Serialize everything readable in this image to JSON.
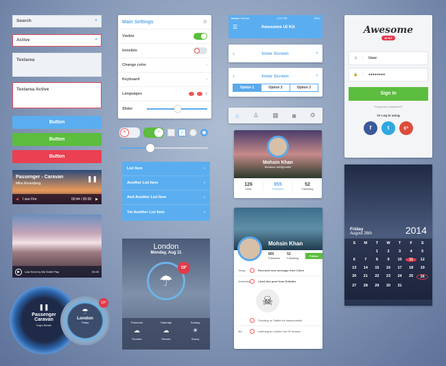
{
  "fields": {
    "search": "Search",
    "active": "Active",
    "textarea": "Textarea",
    "textarea_active": "Textarea Active"
  },
  "buttons": {
    "blue": "Button",
    "green": "Button",
    "red": "Button"
  },
  "music": {
    "title": "Passenger - Caravan",
    "artist": "Mike Rosenberg",
    "track": "I see Fire",
    "time": "00:44 / 05:00"
  },
  "video": {
    "caption": "Last Seen by Ms Smith Play",
    "time": "00:45"
  },
  "settings": {
    "title": "Main Settings",
    "rows": [
      "Visible",
      "Invisible",
      "Change color",
      "Keyboard",
      "Languages",
      "Slider"
    ]
  },
  "list": {
    "items": [
      "List Item",
      "Another List Item",
      "And Another List Item",
      "Yet Another List Item"
    ]
  },
  "weather": {
    "city": "London",
    "date": "Monday, Aug 11",
    "temp": "19°",
    "days": [
      "Tomorrow",
      "Saturday",
      "Sunday"
    ],
    "conds": [
      "Thunder",
      "Shower",
      "Sunny"
    ]
  },
  "phone": {
    "carrier": "●●●●● Verizon",
    "clock": "4:21 PM",
    "battery": "51%",
    "title": "Awesome UI Kit",
    "inner": "Inner Screen",
    "options": [
      "Option 1",
      "Option 2",
      "Option 3"
    ]
  },
  "profile": {
    "name": "Mohsin Khan",
    "sub": "Behance.net/@profile",
    "stats": [
      {
        "n": "126",
        "l": "Likes"
      },
      {
        "n": "855",
        "l": "Followers"
      },
      {
        "n": "52",
        "l": "Following"
      }
    ]
  },
  "feed": {
    "name": "Mohsin Khan",
    "stats": [
      {
        "n": "855",
        "l": "Followers"
      },
      {
        "n": "52",
        "l": "Following"
      }
    ],
    "follow": "Follow",
    "items": [
      "Received new message from Client",
      "Liked this post from Dribbble",
      "Trending on Twitter for #awesomekit",
      "Listening to Locked Out Of Heaven"
    ],
    "times": [
      "Today",
      "Yesterday",
      "",
      "4th"
    ]
  },
  "login": {
    "logo": "Awesome",
    "badge": "UI KIT",
    "user": "User",
    "pass": "●●●●●●●●",
    "signin": "Sign In",
    "forgot": "Forgot your password?",
    "or": "Or Log In using",
    "social": [
      "f",
      "t",
      "g+"
    ]
  },
  "calendar": {
    "day": "Friday",
    "date": "August 26th",
    "year": "2014",
    "weekdays": [
      "S",
      "M",
      "T",
      "W",
      "T",
      "F",
      "S"
    ],
    "days": [
      "",
      "",
      "1",
      "2",
      "3",
      "4",
      "5",
      "6",
      "7",
      "8",
      "9",
      "10",
      "11",
      "12",
      "13",
      "14",
      "15",
      "16",
      "17",
      "18",
      "19",
      "20",
      "21",
      "22",
      "23",
      "24",
      "25",
      "26",
      "27",
      "28",
      "29",
      "30",
      "31",
      "",
      ""
    ]
  },
  "circle": {
    "title": "Passenger Caravan",
    "sub": "Kopo Remix",
    "city": "London",
    "when": "Today",
    "temp": "19°"
  }
}
